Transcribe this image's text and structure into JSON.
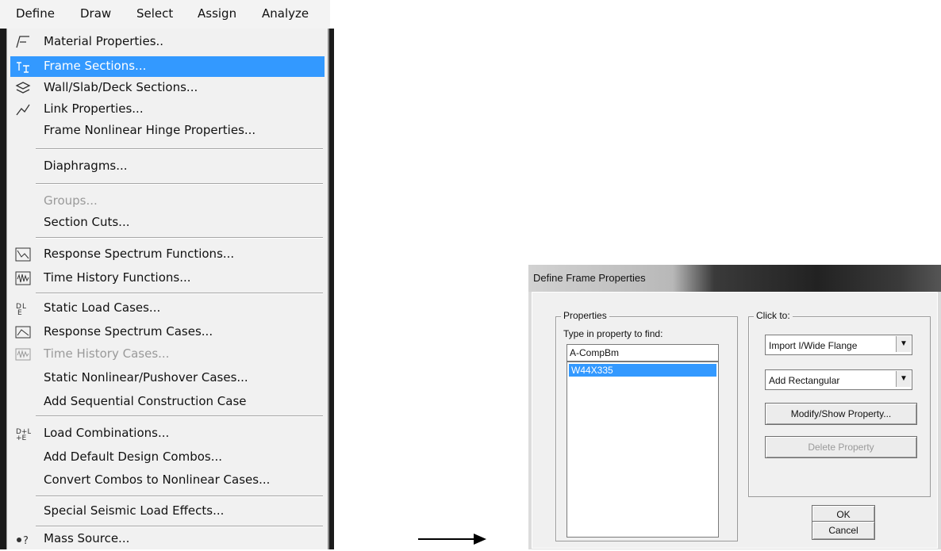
{
  "menubar": {
    "items": [
      "Define",
      "Draw",
      "Select",
      "Assign",
      "Analyze"
    ]
  },
  "menu": {
    "items": [
      {
        "label": "Material Properties..",
        "icon": "material-icon"
      },
      {
        "label": "Frame Sections...",
        "icon": "frame-section-icon",
        "highlighted": true
      },
      {
        "label": "Wall/Slab/Deck Sections...",
        "icon": "wall-slab-icon"
      },
      {
        "label": "Link Properties...",
        "icon": "link-icon"
      },
      {
        "label": "Frame Nonlinear Hinge Properties..."
      },
      {
        "label": "Diaphragms..."
      },
      {
        "label": "Groups...",
        "disabled": true
      },
      {
        "label": "Section Cuts..."
      },
      {
        "label": "Response Spectrum Functions...",
        "icon": "response-spectrum-icon"
      },
      {
        "label": "Time History Functions...",
        "icon": "time-history-icon"
      },
      {
        "label": "Static Load Cases...",
        "icon": "load-case-icon"
      },
      {
        "label": "Response Spectrum Cases...",
        "icon": "spectrum-case-icon"
      },
      {
        "label": "Time History Cases...",
        "icon": "time-history-case-icon",
        "disabled": true
      },
      {
        "label": "Static Nonlinear/Pushover Cases..."
      },
      {
        "label": "Add Sequential Construction Case"
      },
      {
        "label": "Load Combinations...",
        "icon": "load-combo-icon"
      },
      {
        "label": "Add Default Design Combos..."
      },
      {
        "label": "Convert Combos to Nonlinear Cases..."
      },
      {
        "label": "Special Seismic Load Effects..."
      },
      {
        "label": "Mass Source...",
        "icon": "mass-source-icon"
      }
    ]
  },
  "dialog": {
    "title": "Define Frame Properties",
    "properties": {
      "group_title": "Properties",
      "find_label": "Type in property to find:",
      "find_value": "A-CompBm",
      "list_items": [
        "W44X335"
      ]
    },
    "click_to": {
      "group_title": "Click to:",
      "import_combo": "Import I/Wide Flange",
      "add_combo": "Add Rectangular",
      "modify_button": "Modify/Show Property...",
      "delete_button": "Delete Property"
    },
    "ok_button": "OK",
    "cancel_button": "Cancel"
  },
  "colors": {
    "highlight": "#3399ff",
    "menu_bg": "#f1f1f1",
    "dialog_bg": "#f0f0f0"
  }
}
